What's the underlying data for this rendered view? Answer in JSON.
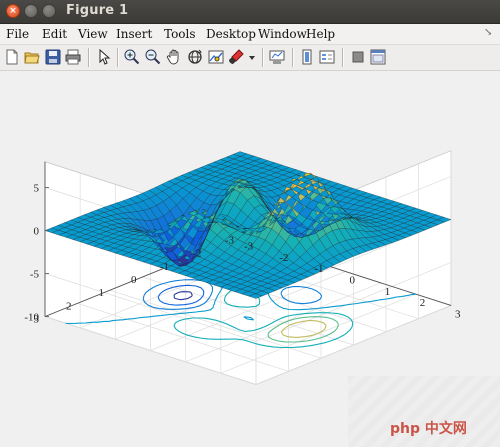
{
  "window": {
    "title": "Figure 1",
    "close_glyph": "×"
  },
  "menu": {
    "items": [
      "File",
      "Edit",
      "View",
      "Insert",
      "Tools",
      "Desktop",
      "Window",
      "Help"
    ],
    "overflow": "↘"
  },
  "toolbar": {
    "buttons": [
      "new-figure-icon",
      "open-file-icon",
      "save-icon",
      "print-icon",
      "select-arrow-icon",
      "zoom-in-icon",
      "zoom-out-icon",
      "pan-hand-icon",
      "rotate-3d-icon",
      "data-cursor-icon",
      "brush-icon",
      "brush-dropdown-icon",
      "link-plot-icon",
      "insert-colorbar-icon",
      "insert-legend-icon",
      "hide-plot-tools-icon",
      "show-plot-tools-icon"
    ]
  },
  "chart_data": {
    "type": "surface",
    "function": "peaks",
    "colormap": "parula",
    "contour_below": true,
    "grid": true,
    "z_ticks": [
      "5",
      "0",
      "-5",
      "-10"
    ],
    "x_ticks": [
      "3",
      "2",
      "1",
      "0",
      "-1",
      "-2",
      "-3"
    ],
    "y_ticks": [
      "-3",
      "-2",
      "-1",
      "0",
      "1",
      "2",
      "3"
    ],
    "xlim": [
      -3,
      3
    ],
    "ylim": [
      -3,
      3
    ],
    "zlim": [
      -10,
      8
    ]
  },
  "watermark": {
    "text": "php 中文网"
  }
}
